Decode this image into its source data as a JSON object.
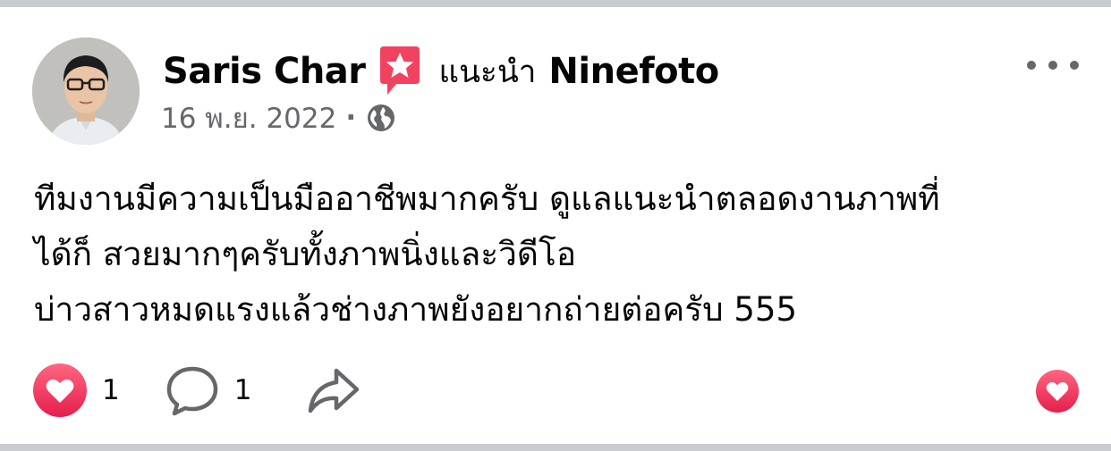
{
  "post": {
    "author_name": "Saris Char",
    "recommend_text": "แนะนำ",
    "page_name": "Ninefoto",
    "date": "16 พ.ย. 2022",
    "separator": "·",
    "privacy_icon": "globe-icon",
    "body_lines": [
      "ทีมงานมีความเป็นมืออาชีพมากครับ ดูแลแนะนำตลอดงานภาพที่",
      "ได้ก็ สวยมากๆครับทั้งภาพนิ่งและวิดีโอ",
      "บ่าวสาวหมดแรงแล้วช่างภาพยังอยากถ่ายต่อครับ 555"
    ]
  },
  "actions": {
    "reaction_count": "1",
    "comment_count": "1",
    "icons": [
      "heart-reaction-icon",
      "comment-icon",
      "share-icon",
      "love-icon"
    ]
  },
  "colors": {
    "text_primary": "#050505",
    "text_secondary": "#65676b",
    "recommend_badge": "#f3425f",
    "heart_gradient_top": "#ff6680",
    "heart_gradient_bottom": "#e61e4d",
    "divider": "#c9ccd1"
  }
}
